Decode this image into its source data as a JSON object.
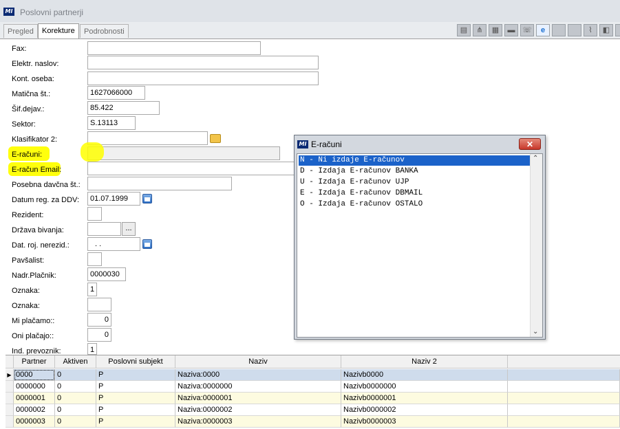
{
  "window": {
    "title": "Poslovni partnerji",
    "logo_text": "MI"
  },
  "tabs": [
    {
      "label": "Pregled",
      "active": false
    },
    {
      "label": "Korekture",
      "active": true
    },
    {
      "label": "Podrobnosti",
      "active": false
    }
  ],
  "toolbar": {
    "icons": [
      "document-icon",
      "tree-icon",
      "grid-icon",
      "keyboard-icon",
      "phone-icon",
      "browser-icon",
      "blank-icon",
      "blank-icon",
      "paperclip-icon",
      "tag-icon",
      "blank-icon"
    ]
  },
  "form": {
    "fax": {
      "label": "Fax:",
      "value": ""
    },
    "email": {
      "label": "Elektr. naslov:",
      "value": ""
    },
    "contact": {
      "label": "Kont. oseba:",
      "value": ""
    },
    "maticna": {
      "label": "Matična št.:",
      "value": "1627066000"
    },
    "sifdejav": {
      "label": "Šif.dejav.:",
      "value": "85.422"
    },
    "sektor": {
      "label": "Sektor:",
      "value": "S.13113"
    },
    "klasifikator2": {
      "label": "Klasifikator 2:",
      "value": ""
    },
    "eracuni": {
      "label": "E-računi:",
      "value": ""
    },
    "eracun_email": {
      "label": "E-račun Email:",
      "value": ""
    },
    "posebna_davcna": {
      "label": "Posebna davčna št.:",
      "value": ""
    },
    "datum_ddv": {
      "label": "Datum reg. za DDV:",
      "value": "01.07.1999"
    },
    "rezident": {
      "label": "Rezident:",
      "value": ""
    },
    "drzava": {
      "label": "Država bivanja:",
      "value": "",
      "button": "..."
    },
    "dat_roj": {
      "label": "Dat. roj. nerezid.:",
      "value": ". ."
    },
    "pavsalist": {
      "label": "Pavšalist:",
      "value": ""
    },
    "nadr_placnik": {
      "label": "Nadr.Plačnik:",
      "value": "0000030"
    },
    "oznaka1": {
      "label": "Oznaka:",
      "value": "1"
    },
    "oznaka2": {
      "label": "Oznaka:",
      "value": ""
    },
    "mi_placamo": {
      "label": "Mi plačamo::",
      "value": "0"
    },
    "oni_placajo": {
      "label": "Oni plačajo::",
      "value": "0"
    },
    "ind_prevoznik": {
      "label": "Ind. prevoznik:",
      "value": "1"
    }
  },
  "highlight_color": "#ffff00",
  "grid": {
    "columns": [
      "Partner",
      "Aktiven",
      "Poslovni subjekt",
      "Naziv",
      "Naziv 2"
    ],
    "rows": [
      [
        "0000",
        "0",
        "P",
        "Naziva:0000",
        "Nazivb0000"
      ],
      [
        "0000000",
        "0",
        "P",
        "Naziva:0000000",
        "Nazivb0000000"
      ],
      [
        "0000001",
        "0",
        "P",
        "Naziva:0000001",
        "Nazivb0000001"
      ],
      [
        "0000002",
        "0",
        "P",
        "Naziva:0000002",
        "Nazivb0000002"
      ],
      [
        "0000003",
        "0",
        "P",
        "Naziva:0000003",
        "Nazivb0000003"
      ]
    ],
    "row_colors": {
      "selected": "#cfdcec",
      "alt": "#fdfbe0",
      "plain": "#ffffff"
    }
  },
  "popup": {
    "title": "E-računi",
    "close_label": "✕",
    "options": [
      "N - Ni izdaje E-računov",
      "D - Izdaja E-računov BANKA",
      "U - Izdaja E-računov UJP",
      "E - Izdaja E-računov DBMAIL",
      "O - Izdaja E-računov OSTALO"
    ],
    "selected_index": 0
  }
}
